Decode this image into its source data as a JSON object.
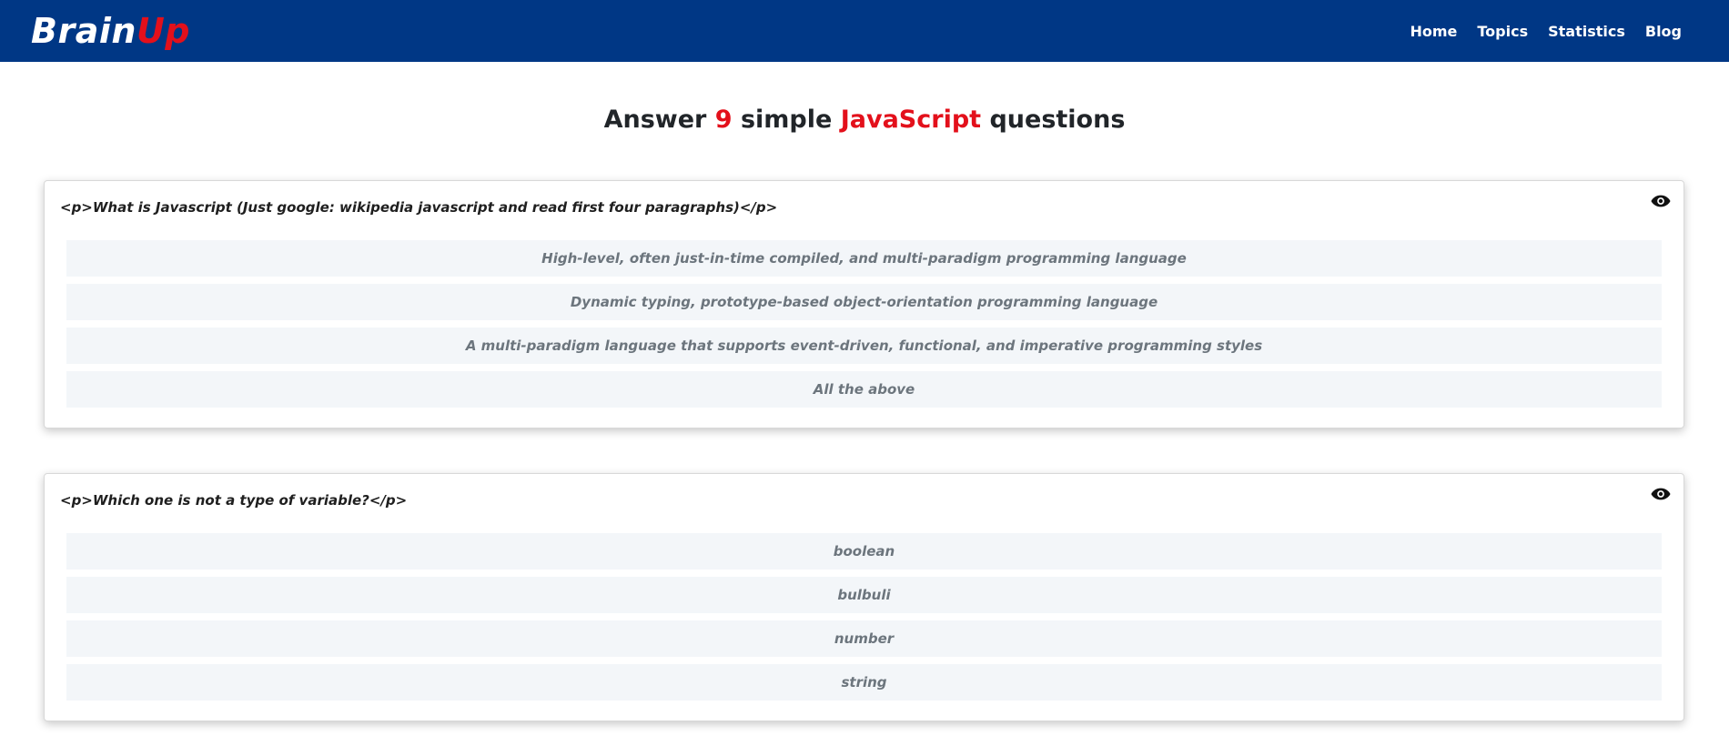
{
  "colors": {
    "nav_bg": "#003785",
    "accent_red": "#e3101b"
  },
  "header": {
    "logo_part1": "Brain",
    "logo_part2": "Up",
    "nav": [
      "Home",
      "Topics",
      "Statistics",
      "Blog"
    ]
  },
  "title": {
    "prefix": "Answer",
    "count": "9",
    "middle": "simple",
    "topic": "JavaScript",
    "suffix": "questions"
  },
  "questions": [
    {
      "text": "<p>What is Javascript (Just google: wikipedia javascript and read first four paragraphs)</p>",
      "icon": "eye-icon",
      "options": [
        "High-level, often just-in-time compiled, and multi-paradigm programming language",
        "Dynamic typing, prototype-based object-orientation programming language",
        "A multi-paradigm language that supports event-driven, functional, and imperative programming styles",
        "All the above"
      ]
    },
    {
      "text": "<p>Which one is not a type of variable?</p>",
      "icon": "eye-icon",
      "options": [
        "boolean",
        "bulbuli",
        "number",
        "string"
      ]
    }
  ]
}
